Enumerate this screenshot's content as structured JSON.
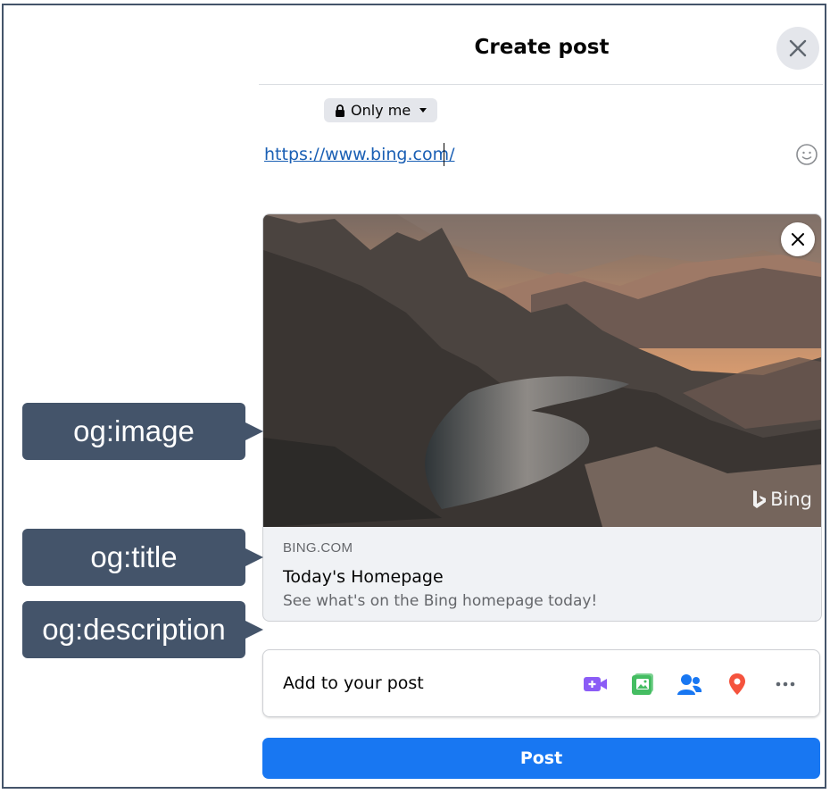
{
  "dialog": {
    "title": "Create post",
    "audience_label": "Only me"
  },
  "composer": {
    "url_text": "https://www.bing.com/"
  },
  "link_preview": {
    "domain": "BING.COM",
    "title": "Today's Homepage",
    "description": "See what's on the Bing homepage today!",
    "watermark": "Bing"
  },
  "callouts": {
    "image": "og:image",
    "title": "og:title",
    "description": "og:description"
  },
  "add_to_post": {
    "label": "Add to your post",
    "icons": [
      "live-video-icon",
      "photo-video-icon",
      "tag-people-icon",
      "check-in-icon",
      "more-icon"
    ]
  },
  "post_button": {
    "label": "Post"
  },
  "colors": {
    "accent": "#1877f2",
    "callout": "#44546a",
    "video": "#8b5cf6",
    "photo": "#45bd62",
    "people": "#1877f2",
    "location": "#f5533d"
  }
}
